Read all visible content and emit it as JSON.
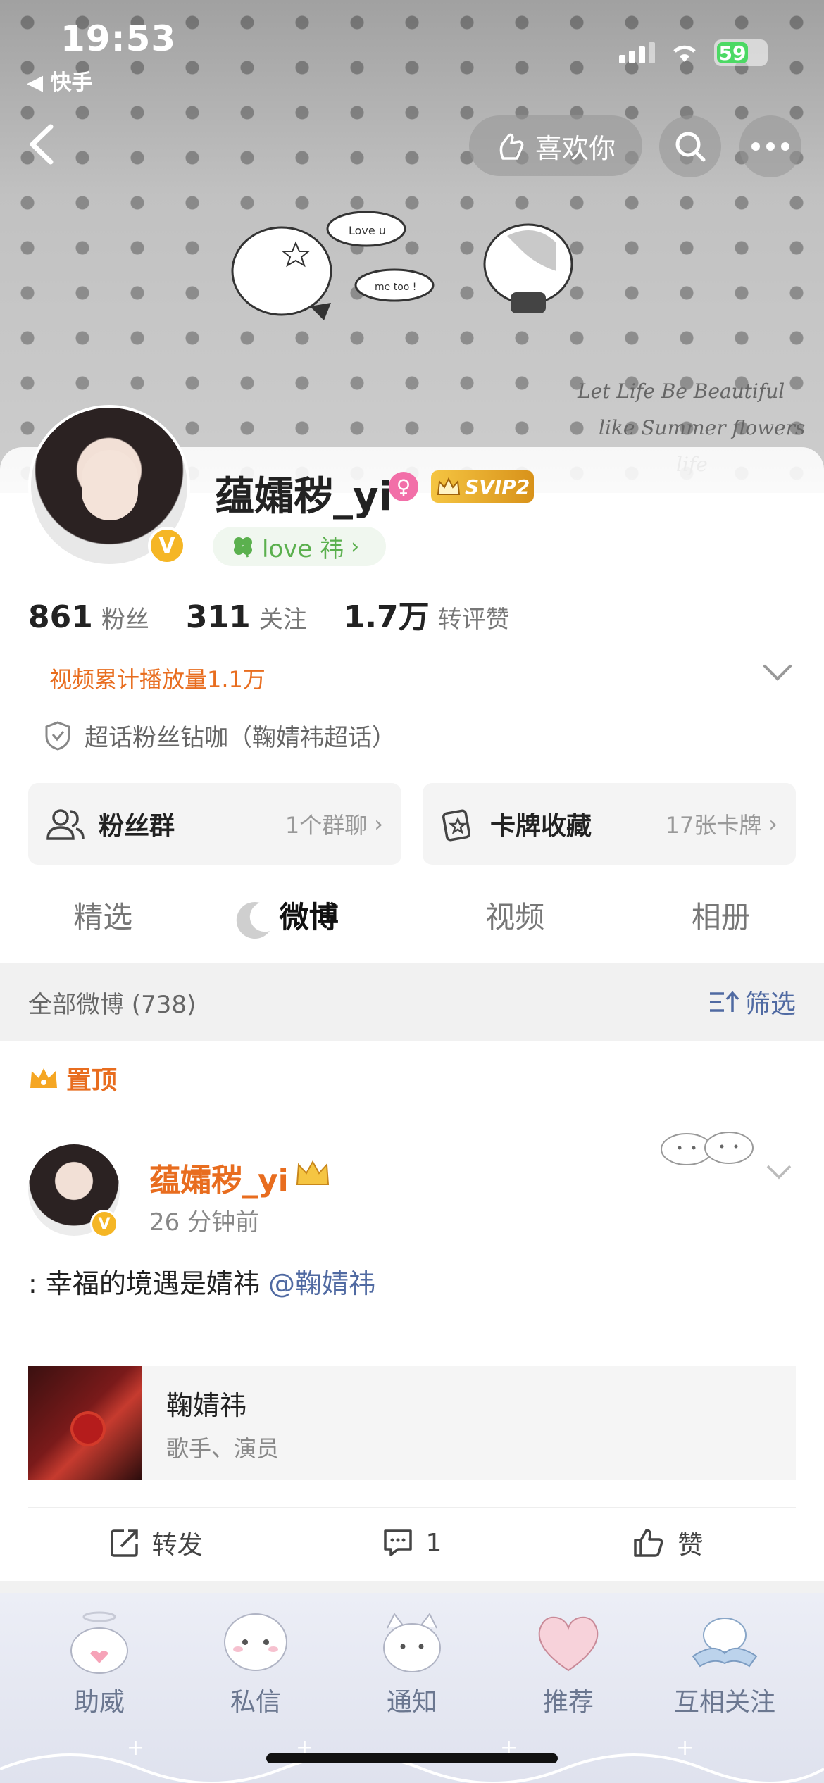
{
  "status_bar": {
    "time": "19:53",
    "back_app": "◀ 快手",
    "battery": "59"
  },
  "header": {
    "like_label": "喜欢你",
    "cover_text_line1": "Let Life Be Beautiful",
    "cover_text_line2": "like Summer flowers",
    "cover_text_line3": "life",
    "cartoon_bubble1": "Love u",
    "cartoon_bubble2": "me too !"
  },
  "profile": {
    "username": "蕴孀秽_yi",
    "verified_mark": "V",
    "svip_label": "SVIP2",
    "tag_label": "love 祎",
    "stats": [
      {
        "num": "861",
        "label": "粉丝"
      },
      {
        "num": "311",
        "label": "关注"
      },
      {
        "num": "1.7万",
        "label": "转评赞"
      }
    ],
    "play_count": "视频累计播放量1.1万",
    "chaohua": "超话粉丝钻咖（鞠婧祎超话）",
    "cards": [
      {
        "title": "粉丝群",
        "meta": "1个群聊"
      },
      {
        "title": "卡牌收藏",
        "meta": "17张卡牌"
      }
    ]
  },
  "tabs": [
    {
      "label": "精选"
    },
    {
      "label": "微博"
    },
    {
      "label": "视频"
    },
    {
      "label": "相册"
    }
  ],
  "feed": {
    "all_label": "全部微博 (738)",
    "filter_label": "筛选",
    "pinned_label": "置顶",
    "post": {
      "author": "蕴孀秽_yi",
      "time": "26 分钟前",
      "text": ": 幸福的境遇是婧祎 ",
      "mention": "@鞠婧祎",
      "link_title": "鞠婧祎",
      "link_sub": "歌手、演员",
      "repost": "转发",
      "comments": "1",
      "like": "赞"
    }
  },
  "bottom_bar": [
    {
      "label": "助威"
    },
    {
      "label": "私信"
    },
    {
      "label": "通知"
    },
    {
      "label": "推荐"
    },
    {
      "label": "互相关注"
    }
  ],
  "colors": {
    "accent_orange": "#e86d1f",
    "link_blue": "#506aa2",
    "green_tag": "#5bb04e",
    "vip_gold": "#f5b625"
  }
}
